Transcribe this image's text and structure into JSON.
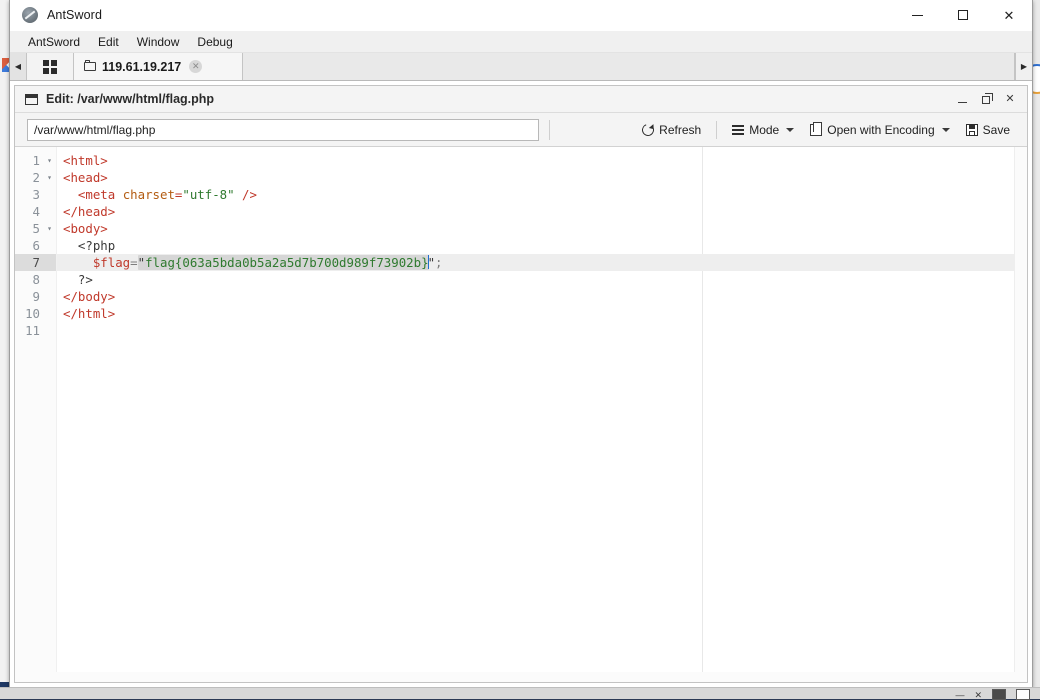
{
  "window": {
    "app_title": "AntSword",
    "app_icon": "antsword-logo-icon",
    "controls": {
      "minimize": "minimize-icon",
      "maximize": "maximize-icon",
      "close": "close-icon",
      "close_glyph": "✕"
    }
  },
  "menu": {
    "items": [
      {
        "label": "AntSword"
      },
      {
        "label": "Edit"
      },
      {
        "label": "Window"
      },
      {
        "label": "Debug"
      }
    ]
  },
  "tabs": {
    "scroll_left_glyph": "◀",
    "scroll_right_glyph": "▶",
    "grid_button_name": "shell-manager-grid-button",
    "items": [
      {
        "label": "119.61.19.217",
        "icon": "folder-icon",
        "close_glyph": "✕",
        "active": true
      }
    ]
  },
  "editor_window": {
    "title": "Edit: /var/www/html/flag.php",
    "title_icon": "window-icon",
    "controls": {
      "minimize": "minimize-icon",
      "restore": "restore-icon",
      "close": "close-icon",
      "close_glyph": "✕"
    }
  },
  "toolbar": {
    "path_value": "/var/www/html/flag.php",
    "path_placeholder": "/var/www/html/",
    "refresh_label": "Refresh",
    "mode_label": "Mode",
    "encoding_label": "Open with Encoding",
    "save_label": "Save"
  },
  "code": {
    "gutter": [
      {
        "num": "1",
        "fold": "▾"
      },
      {
        "num": "2",
        "fold": "▾"
      },
      {
        "num": "3",
        "fold": ""
      },
      {
        "num": "4",
        "fold": ""
      },
      {
        "num": "5",
        "fold": "▾"
      },
      {
        "num": "6",
        "fold": ""
      },
      {
        "num": "7",
        "fold": ""
      },
      {
        "num": "8",
        "fold": ""
      },
      {
        "num": "9",
        "fold": ""
      },
      {
        "num": "10",
        "fold": ""
      },
      {
        "num": "11",
        "fold": ""
      }
    ],
    "active_line": 7,
    "flag_value": "flag{063a5bda0b5a2a5d7b700d989f73902b}",
    "lines": [
      {
        "n": 1,
        "text": "<html>"
      },
      {
        "n": 2,
        "text": "<head>"
      },
      {
        "n": 3,
        "text": "  <meta charset=\"utf-8\" />"
      },
      {
        "n": 4,
        "text": "</head>"
      },
      {
        "n": 5,
        "text": "<body>"
      },
      {
        "n": 6,
        "text": "  <?php"
      },
      {
        "n": 7,
        "text": "    $flag=\"flag{063a5bda0b5a2a5d7b700d989f73902b}\";"
      },
      {
        "n": 8,
        "text": "  ?>"
      },
      {
        "n": 9,
        "text": "</body>"
      },
      {
        "n": 10,
        "text": "</html>"
      },
      {
        "n": 11,
        "text": ""
      }
    ]
  },
  "colors": {
    "tag": "#c0392b",
    "attribute": "#b35c12",
    "string": "#2f7a2f",
    "plain": "#3a3a3a",
    "active_line_bg": "#eeeeee",
    "selection_bg": "#d6d6d6",
    "cursor": "#1f6fd0",
    "desktop": "#1f3864"
  },
  "taskbar": {
    "items": [
      "—",
      "✕"
    ]
  }
}
